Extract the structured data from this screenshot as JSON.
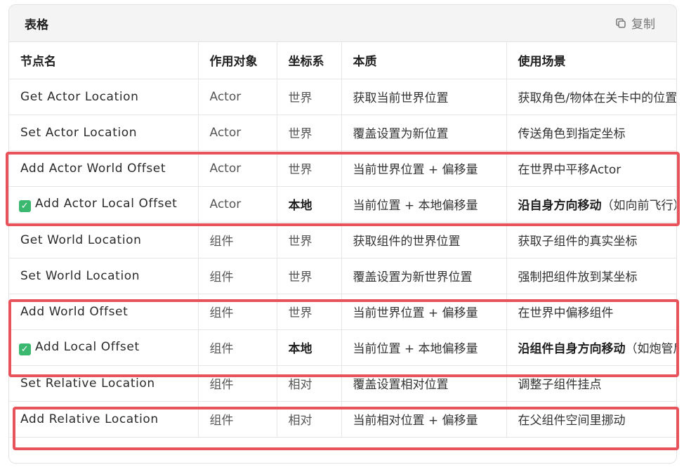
{
  "card": {
    "title": "表格",
    "copy_label": "复制"
  },
  "table": {
    "headers": [
      "节点名",
      "作用对象",
      "坐标系",
      "本质",
      "使用场景"
    ],
    "rows": [
      {
        "node": "Get Actor Location",
        "target": "Actor",
        "space": "世界",
        "essence": "获取当前世界位置",
        "usage": "获取角色/物体在关卡中的位置",
        "checked": false
      },
      {
        "node": "Set Actor Location",
        "target": "Actor",
        "space": "世界",
        "essence": "覆盖设置为新位置",
        "usage": "传送角色到指定坐标",
        "checked": false
      },
      {
        "node": "Add Actor World Offset",
        "target": "Actor",
        "space": "世界",
        "essence": "当前世界位置 + 偏移量",
        "usage": "在世界中平移Actor",
        "checked": false
      },
      {
        "node": "Add Actor Local Offset",
        "target": "Actor",
        "space": "本地",
        "essence": "当前位置 + 本地偏移量",
        "usage_bold": "沿自身方向移动",
        "usage_rest": "（如向前飞行）",
        "checked": true
      },
      {
        "node": "Get World Location",
        "target": "组件",
        "space": "世界",
        "essence": "获取组件的世界位置",
        "usage": "获取子组件的真实坐标",
        "checked": false
      },
      {
        "node": "Set World Location",
        "target": "组件",
        "space": "世界",
        "essence": "覆盖设置为新世界位置",
        "usage": "强制把组件放到某坐标",
        "checked": false
      },
      {
        "node": "Add World Offset",
        "target": "组件",
        "space": "世界",
        "essence": "当前世界位置 + 偏移量",
        "usage": "在世界中偏移组件",
        "checked": false
      },
      {
        "node": "Add Local Offset",
        "target": "组件",
        "space": "本地",
        "essence": "当前位置 + 本地偏移量",
        "usage_bold": "沿组件自身方向移动",
        "usage_rest": "（如炮管后坐）",
        "checked": true
      },
      {
        "node": "Set Relative Location",
        "target": "组件",
        "space": "相对",
        "essence": "覆盖设置相对位置",
        "usage": "调整子组件挂点",
        "checked": false
      },
      {
        "node": "Add Relative Location",
        "target": "组件",
        "space": "相对",
        "essence": "当前相对位置 + 偏移量",
        "usage": "在父组件空间里挪动",
        "checked": false
      }
    ]
  },
  "colors": {
    "highlight": "#e8525b",
    "check": "#3bb86f"
  },
  "icons": {
    "copy": "copy-icon",
    "check": "check-icon"
  }
}
